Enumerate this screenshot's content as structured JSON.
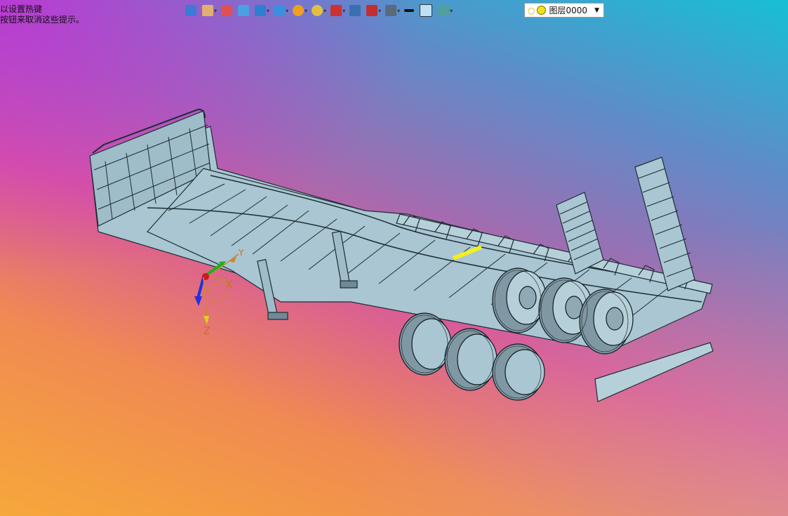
{
  "hint": {
    "line1": "以设置热键",
    "line2": "按钮来取消这些提示。"
  },
  "toolbar": {
    "items": [
      {
        "icon": "user-coordinate-icon",
        "color": "#3a7bd5",
        "has_dropdown": false
      },
      {
        "icon": "pan-hand-icon",
        "color": "#e0b070",
        "has_dropdown": true
      },
      {
        "icon": "pencil-icon",
        "color": "#e05050",
        "has_dropdown": false
      },
      {
        "icon": "box-shaded-icon",
        "color": "#4aa0e0",
        "has_dropdown": false
      },
      {
        "icon": "cube-icon",
        "color": "#2f7fd0",
        "has_dropdown": true
      },
      {
        "icon": "cube-views-icon",
        "color": "#3b8ee0",
        "has_dropdown": true
      },
      {
        "icon": "render-sphere-icon",
        "color": "#f0a020",
        "has_dropdown": true
      },
      {
        "icon": "zoom-icon",
        "color": "#e0c040",
        "has_dropdown": true
      },
      {
        "icon": "snap-icon",
        "color": "#d03030",
        "has_dropdown": true
      },
      {
        "icon": "frame-icon",
        "color": "#3a6fb0",
        "has_dropdown": false
      },
      {
        "icon": "section-icon",
        "color": "#c03030",
        "has_dropdown": true
      },
      {
        "icon": "display-monitor-icon",
        "color": "#5a6a7a",
        "has_dropdown": true
      },
      {
        "icon": "line-black-icon",
        "color": "#111111",
        "has_dropdown": false
      },
      {
        "icon": "color-swatch-icon",
        "color": "#bfe0f5",
        "has_dropdown": false
      },
      {
        "icon": "layers-icon",
        "color": "#50a0a0",
        "has_dropdown": true
      }
    ]
  },
  "layer": {
    "name": "图层0000"
  },
  "axes": {
    "x": "X",
    "y": "Y",
    "z": "Z"
  },
  "colors": {
    "model_fill": "#a9c6d2",
    "model_stroke": "#1d2c33",
    "tire": "#8fa9b5",
    "highlight": "#f0f020"
  }
}
